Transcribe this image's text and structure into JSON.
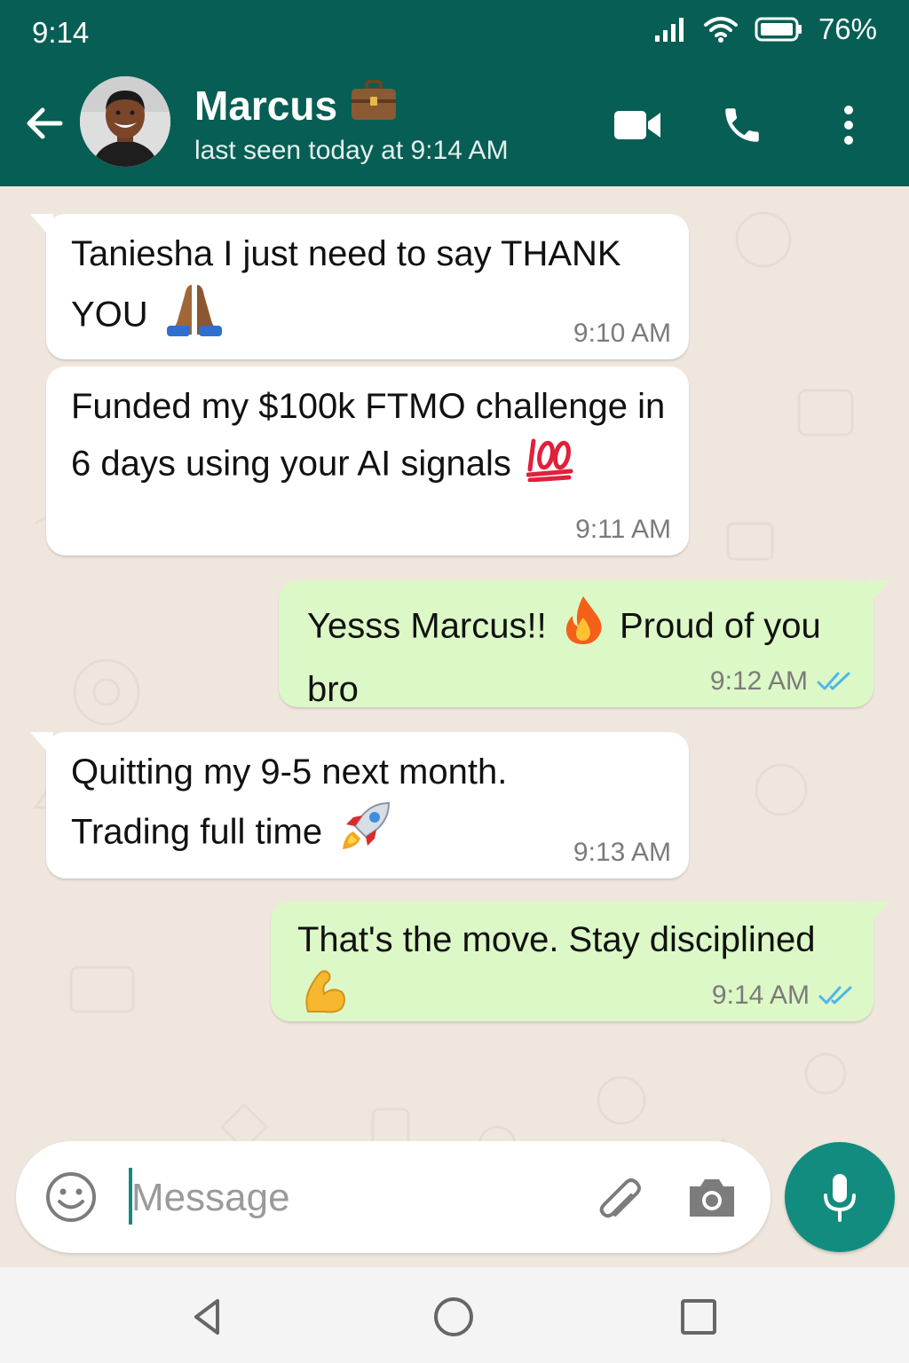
{
  "status_bar": {
    "time": "9:14",
    "battery": "76%"
  },
  "header": {
    "contact_name": "Marcus",
    "name_emoji": "💼",
    "last_seen": "last seen today at 9:14 AM"
  },
  "messages": [
    {
      "direction": "incoming",
      "text": "Taniesha I just need to say THANK YOU",
      "emoji": "🙏",
      "time": "9:10 AM"
    },
    {
      "direction": "incoming",
      "text": "Funded my $100k FTMO challenge in 6 days using your AI signals",
      "emoji": "💯",
      "time": "9:11 AM"
    },
    {
      "direction": "outgoing",
      "text_before": "Yesss Marcus!!",
      "emoji": "🔥",
      "text_after": "Proud of you bro",
      "time": "9:12 AM",
      "status": "read"
    },
    {
      "direction": "incoming",
      "text": "Quitting my 9-5 next month. Trading full time",
      "emoji": "🚀",
      "time": "9:13 AM"
    },
    {
      "direction": "outgoing",
      "text": "That's the move. Stay disciplined",
      "emoji": "💪",
      "time": "9:14 AM",
      "status": "read"
    }
  ],
  "composer": {
    "placeholder": "Message",
    "value": ""
  },
  "colors": {
    "header": "#075e54",
    "outgoing_bubble": "#dcf8c6",
    "incoming_bubble": "#ffffff",
    "accent": "#128c7e",
    "read_ticks": "#4fb6ec",
    "chat_background": "#efe7de"
  },
  "icons": [
    "signal-icon",
    "wifi-icon",
    "battery-icon",
    "back-arrow-icon",
    "video-call-icon",
    "phone-icon",
    "more-vert-icon",
    "emoji-icon",
    "attach-icon",
    "camera-icon",
    "mic-icon",
    "nav-back-icon",
    "nav-home-icon",
    "nav-recents-icon",
    "double-check-icon"
  ]
}
